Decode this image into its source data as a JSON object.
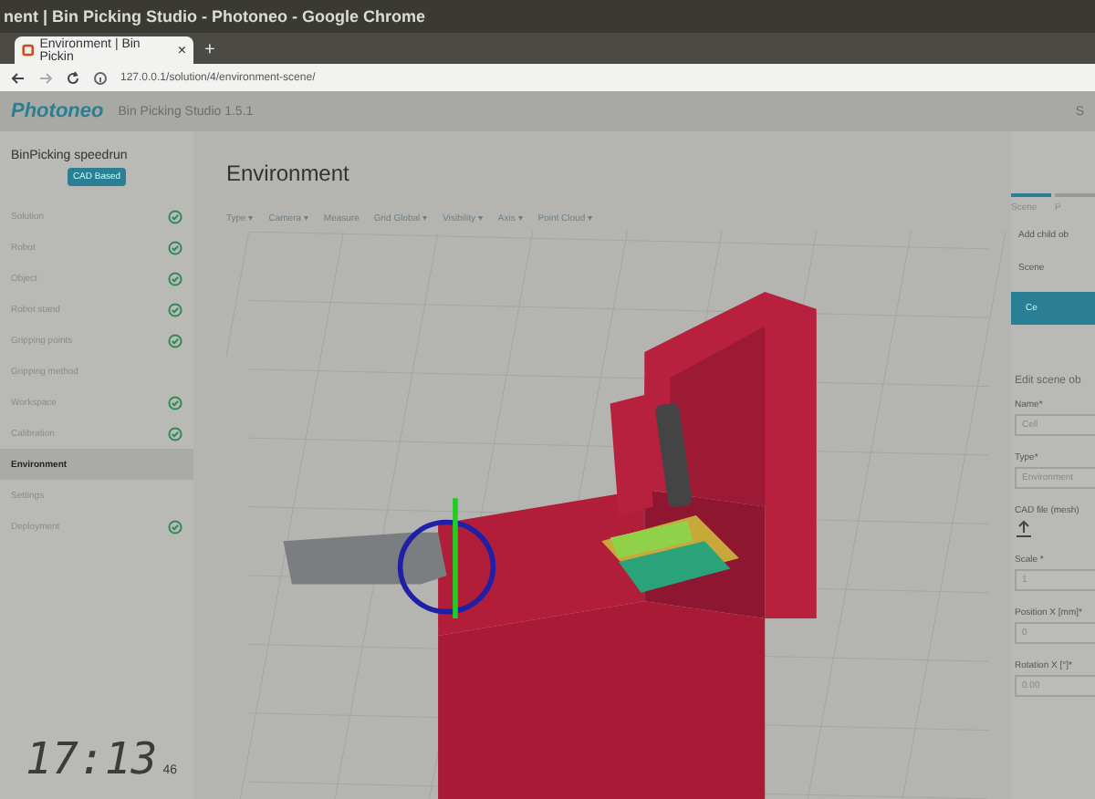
{
  "window": {
    "title": "nent | Bin Picking Studio - Photoneo - Google Chrome"
  },
  "browser_tab": {
    "title": "Environment | Bin Pickin",
    "close": "×",
    "new_tab": "+"
  },
  "address_bar": {
    "url": "127.0.0.1/solution/4/environment-scene/"
  },
  "app_header": {
    "logo": "Photoneo",
    "product": "Bin Picking Studio 1.5.1",
    "right_text": "S"
  },
  "sidebar": {
    "solution_name": "BinPicking speedrun",
    "badge": "CAD Based",
    "items": [
      {
        "label": "Solution",
        "checked": true,
        "selected": false
      },
      {
        "label": "Robot",
        "checked": true,
        "selected": false
      },
      {
        "label": "Object",
        "checked": true,
        "selected": false
      },
      {
        "label": "Robot stand",
        "checked": true,
        "selected": false
      },
      {
        "label": "Gripping points",
        "checked": true,
        "selected": false
      },
      {
        "label": "Gripping method",
        "checked": false,
        "selected": false
      },
      {
        "label": "Workspace",
        "checked": true,
        "selected": false
      },
      {
        "label": "Calibration",
        "checked": true,
        "selected": false
      },
      {
        "label": "Environment",
        "checked": false,
        "selected": true
      },
      {
        "label": "Settings",
        "checked": false,
        "selected": false
      },
      {
        "label": "Deployment",
        "checked": true,
        "selected": false
      }
    ]
  },
  "page": {
    "title": "Environment"
  },
  "toolbar": [
    "Type ▾",
    "Camera ▾",
    "Measure",
    "Grid Global ▾",
    "Visibility ▾",
    "Axis ▾",
    "Point Cloud ▾"
  ],
  "right_panel": {
    "tabs": [
      {
        "label": "Scene",
        "selected": true
      },
      {
        "label": "P",
        "selected": false
      }
    ],
    "add_child": "Add child ob",
    "scene_node": "Scene",
    "selected_node": "Ce",
    "section_title": "Edit scene ob",
    "fields": [
      {
        "kind": "text",
        "label": "Name*",
        "value": "Cell"
      },
      {
        "kind": "text",
        "label": "Type*",
        "value": "Environment"
      },
      {
        "kind": "upload",
        "label": "CAD file (mesh)"
      },
      {
        "kind": "text",
        "label": "Scale *",
        "value": "1"
      },
      {
        "kind": "text",
        "label": "Position X [mm]*",
        "value": "0"
      },
      {
        "kind": "text",
        "label": "Rotation X [°]*",
        "value": "0.00"
      }
    ]
  },
  "clock_overlay": {
    "time": "17:13",
    "seconds": "46"
  }
}
